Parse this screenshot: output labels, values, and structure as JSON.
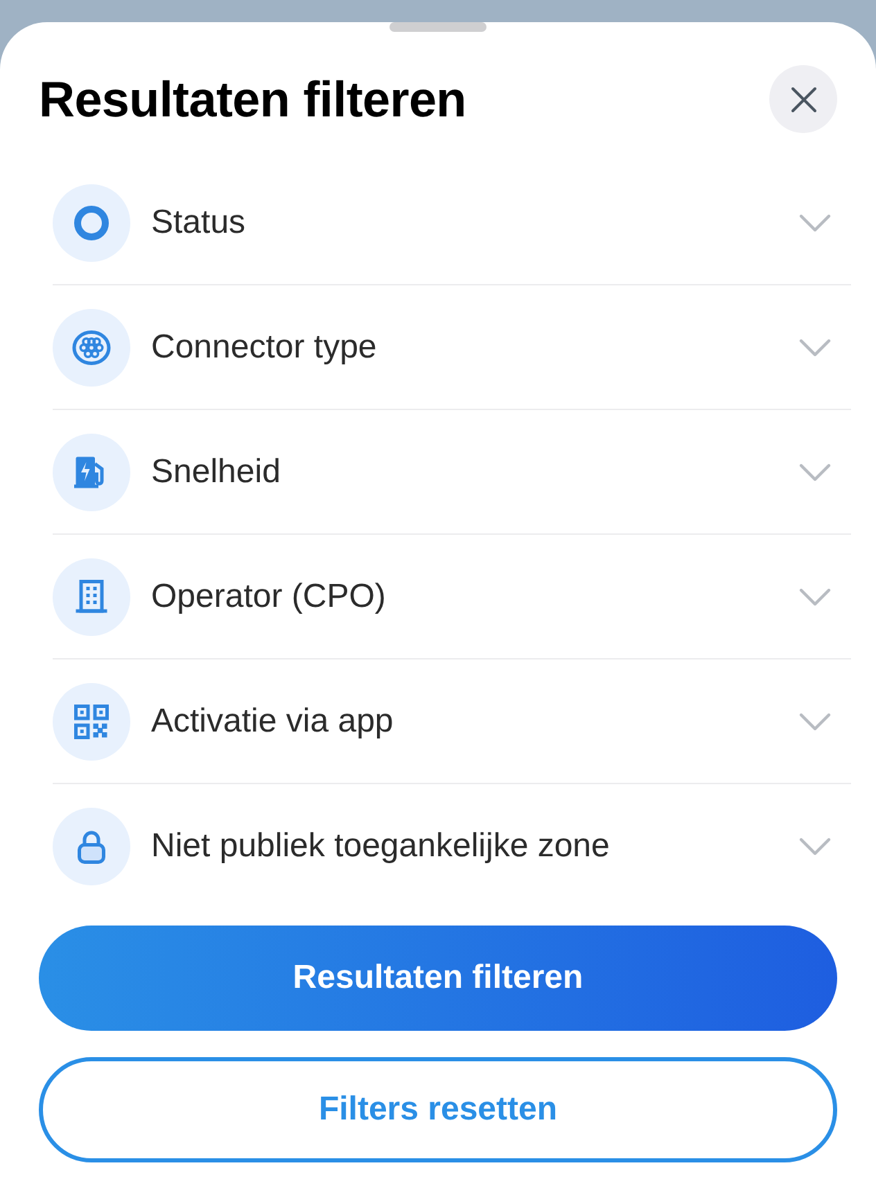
{
  "sheet": {
    "title": "Resultaten filteren"
  },
  "filters": [
    {
      "label": "Status",
      "expanded": false
    },
    {
      "label": "Connector type",
      "expanded": false
    },
    {
      "label": "Snelheid",
      "expanded": false
    },
    {
      "label": "Operator (CPO)",
      "expanded": false
    },
    {
      "label": "Activatie via app",
      "expanded": false
    },
    {
      "label": "Niet publiek toegankelijke zone",
      "expanded": false
    }
  ],
  "buttons": [
    {
      "kind": "primary",
      "label": "Resultaten filteren"
    },
    {
      "kind": "outline",
      "label": "Filters resetten"
    }
  ]
}
